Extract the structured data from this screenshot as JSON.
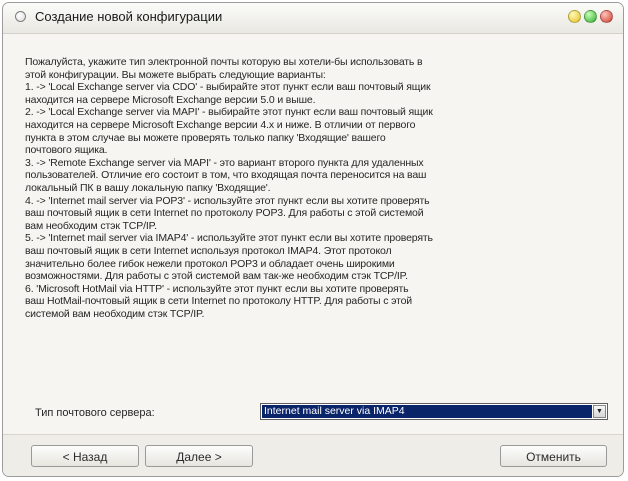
{
  "window": {
    "title": "Создание новой конфигурации"
  },
  "description": {
    "lines": [
      "Пожалуйста, укажите тип электронной почты которую вы хотели-бы использовать в",
      "этой конфигурации. Вы можете выбрать следующие варианты:",
      "1. ->   'Local Exchange server via CDO' - выбирайте этот пункт если ваш почтовый ящик",
      "находится на сервере Microsoft Exchange версии 5.0 и выше.",
      "2. ->   'Local Exchange server via MAPI' - выбирайте этот пункт если ваш почтовый ящик",
      "находится на сервере Microsoft Exchange версии 4.х и ниже. В отличии от первого",
      "пункта в этом случае вы можете проверять только папку 'Входящие' вашего",
      "почтового ящика.",
      "3. ->   'Remote Exchange server via MAPI' - это вариант второго пункта для удаленных",
      "пользователей. Отличие его состоит в том, что входящая почта переносится на ваш",
      "локальный ПК в вашу локальную папку 'Входящие'.",
      "4. ->   'Internet mail server via POP3' - используйте этот пункт если вы хотите проверять",
      "ваш почтовый ящик в сети Internet по протоколу POP3. Для работы с этой системой",
      "вам необходим стэк TCP/IP.",
      "5. ->   'Internet mail server via IMAP4' - используйте этот пункт если вы хотите проверять",
      "ваш почтовый ящик в сети Internet используя протокол IMAP4. Этот протокол",
      "значительно более гибок нежели протокол POP3 и обладает очень широкими",
      "возможностями. Для работы с этой системой вам так-же необходим стэк TCP/IP.",
      "6.       'Microsoft HotMail via HTTP' - используйте этот пункт если вы хотите проверять",
      "ваш HotMail-почтовый ящик в сети Internet по протоколу HTTP. Для работы с этой",
      "системой вам необходим стэк TCP/IP."
    ]
  },
  "server": {
    "label": "Тип почтового сервера:",
    "selected": "Internet mail server via IMAP4"
  },
  "buttons": {
    "back": "< Назад",
    "next": "Далее >",
    "cancel": "Отменить"
  },
  "icons": {
    "title_radio": "radio-icon",
    "dropdown_arrow": "chevron-down-icon"
  },
  "colors": {
    "selection": "#0a246a",
    "minimize_button": "#e3c31e",
    "maximize_button": "#2fae2a",
    "close_button": "#d03b2c"
  }
}
